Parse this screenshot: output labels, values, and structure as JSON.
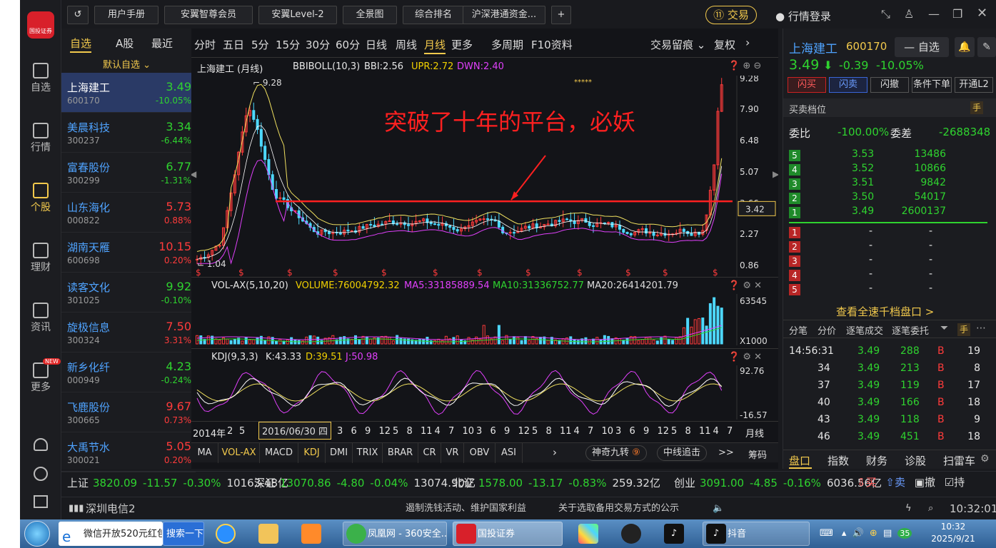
{
  "topbar": {
    "buttons": [
      "用户手册",
      "安翼智尊会员",
      "安翼Level-2",
      "全景图",
      "综合排名",
      "沪深港通资金..."
    ],
    "trade_label": "交易",
    "login_label": "行情登录"
  },
  "rail": [
    {
      "label": "自选",
      "icon": "watchlist-icon"
    },
    {
      "label": "行情",
      "icon": "market-icon"
    },
    {
      "label": "个股",
      "icon": "stock-icon"
    },
    {
      "label": "理财",
      "icon": "finance-icon"
    },
    {
      "label": "资讯",
      "icon": "news-icon"
    },
    {
      "label": "更多",
      "icon": "more-icon",
      "badge": "NEW"
    }
  ],
  "watchlist": {
    "tabs": [
      "自选",
      "A股",
      "最近"
    ],
    "group_label": "默认自选",
    "items": [
      {
        "name": "上海建工",
        "code": "600170",
        "price": "3.49",
        "pct": "-10.05%",
        "dir": "down"
      },
      {
        "name": "美晨科技",
        "code": "300237",
        "price": "3.34",
        "pct": "-6.44%",
        "dir": "down"
      },
      {
        "name": "富春股份",
        "code": "300299",
        "price": "6.77",
        "pct": "-1.31%",
        "dir": "down"
      },
      {
        "name": "山东海化",
        "code": "000822",
        "price": "5.73",
        "pct": "0.88%",
        "dir": "up"
      },
      {
        "name": "湖南天雁",
        "code": "600698",
        "price": "10.15",
        "pct": "0.20%",
        "dir": "up"
      },
      {
        "name": "读客文化",
        "code": "301025",
        "price": "9.92",
        "pct": "-0.10%",
        "dir": "down"
      },
      {
        "name": "旋极信息",
        "code": "300324",
        "price": "7.50",
        "pct": "3.31%",
        "dir": "up"
      },
      {
        "name": "新乡化纤",
        "code": "000949",
        "price": "4.23",
        "pct": "-0.24%",
        "dir": "down"
      },
      {
        "name": "飞鹿股份",
        "code": "300665",
        "price": "9.67",
        "pct": "0.73%",
        "dir": "up"
      },
      {
        "name": "大禹节水",
        "code": "300021",
        "price": "5.05",
        "pct": "0.20%",
        "dir": "up"
      }
    ]
  },
  "chart": {
    "period_tabs": [
      "分时",
      "五日",
      "5分",
      "15分",
      "30分",
      "60分",
      "日线",
      "周线",
      "月线",
      "更多",
      "多周期",
      "F10资料"
    ],
    "right_tabs": [
      "交易留痕",
      "复权"
    ],
    "main_title": "上海建工 (月线)",
    "bbi_label": "BBIBOLL(10,3)",
    "bbi": "BBI:2.56",
    "upr": "UPR:2.72",
    "dwn": "DWN:2.40",
    "annotation": "突破了十年的平台，必妖",
    "hi_label": "9.28",
    "lo_label": "1.04",
    "cursor_value": "3.42",
    "stars": "*****",
    "y_ticks": [
      "9.28",
      "7.90",
      "6.48",
      "5.07",
      "3.66",
      "2.27",
      "0.86"
    ],
    "vol_title": "VOL-AX(5,10,20)",
    "vol": "VOLUME:76004792.32",
    "ma5": "MA5:33185889.54",
    "ma10": "MA10:31336752.77",
    "ma20": "MA20:26414201.79",
    "vol_y": [
      "63545",
      "X1000"
    ],
    "kdj_title": "KDJ(9,3,3)",
    "kdj_k": "K:43.33",
    "kdj_d": "D:39.51",
    "kdj_j": "J:50.98",
    "kdj_y": [
      "92.76",
      "-16.57"
    ],
    "x_start": "2014年",
    "x_ticks": [
      "2",
      "5",
      "8",
      "11",
      "3",
      "6",
      "9",
      "12",
      "5",
      "8",
      "11",
      "4",
      "7",
      "10",
      "3",
      "6",
      "9",
      "12",
      "5",
      "8",
      "11",
      "4",
      "7",
      "10",
      "3",
      "6",
      "9",
      "12",
      "5",
      "8",
      "11",
      "4",
      "7"
    ],
    "date_box": "2016/06/30 四",
    "period_label": "月线",
    "indicators": [
      "MA",
      "VOL-AX",
      "MACD",
      "KDJ",
      "DMI",
      "TRIX",
      "BRAR",
      "CR",
      "VR",
      "OBV",
      "ASI"
    ],
    "special_btns": [
      "神奇九转",
      "中线追击",
      ">>",
      "筹码"
    ]
  },
  "quote": {
    "name": "上海建工",
    "code": "600170",
    "price": "3.49",
    "change": "-0.39",
    "pct": "-10.05%",
    "watch_btn": "自选",
    "actions": [
      "闪买",
      "闪卖",
      "闪撤",
      "条件下单",
      "开通L2"
    ],
    "ob_title": "买卖档位",
    "ratio_label": "委比",
    "ratio": "-100.00%",
    "diff_label": "委差",
    "diff": "-2688348",
    "asks": [
      {
        "lvl": "5",
        "price": "3.53",
        "vol": "13486"
      },
      {
        "lvl": "4",
        "price": "3.52",
        "vol": "10866"
      },
      {
        "lvl": "3",
        "price": "3.51",
        "vol": "9842"
      },
      {
        "lvl": "2",
        "price": "3.50",
        "vol": "54017"
      },
      {
        "lvl": "1",
        "price": "3.49",
        "vol": "2600137"
      }
    ],
    "bids": [
      {
        "lvl": "1",
        "price": "-",
        "vol": "-"
      },
      {
        "lvl": "2",
        "price": "-",
        "vol": "-"
      },
      {
        "lvl": "3",
        "price": "-",
        "vol": "-"
      },
      {
        "lvl": "4",
        "price": "-",
        "vol": "-"
      },
      {
        "lvl": "5",
        "price": "-",
        "vol": "-"
      }
    ],
    "depth_link": "查看全速千档盘口 >",
    "tick_tabs": [
      "分笔",
      "分价",
      "逐笔成交",
      "逐笔委托"
    ],
    "ticks": [
      {
        "t": "14:56:31",
        "p": "3.49",
        "v": "288",
        "s": "B",
        "n": "19"
      },
      {
        "t": "34",
        "p": "3.49",
        "v": "213",
        "s": "B",
        "n": "8"
      },
      {
        "t": "37",
        "p": "3.49",
        "v": "119",
        "s": "B",
        "n": "17"
      },
      {
        "t": "40",
        "p": "3.49",
        "v": "166",
        "s": "B",
        "n": "18"
      },
      {
        "t": "43",
        "p": "3.49",
        "v": "118",
        "s": "B",
        "n": "9"
      },
      {
        "t": "46",
        "p": "3.49",
        "v": "451",
        "s": "B",
        "n": "18"
      }
    ],
    "bottom_tabs": [
      "盘口",
      "指数",
      "财务",
      "诊股",
      "扫雷车"
    ]
  },
  "indices": [
    {
      "name": "上证",
      "v": "3820.09",
      "c": "-11.57",
      "p": "-0.30%",
      "a": "10163.48亿"
    },
    {
      "name": "深证",
      "v": "13070.86",
      "c": "-4.80",
      "p": "-0.04%",
      "a": "13074.90亿"
    },
    {
      "name": "北证",
      "v": "1578.00",
      "c": "-13.17",
      "p": "-0.83%",
      "a": "259.32亿"
    },
    {
      "name": "创业",
      "v": "3091.00",
      "c": "-4.85",
      "p": "-0.16%",
      "a": "6036.56亿"
    }
  ],
  "index_actions": [
    "买",
    "卖",
    "撤",
    "持"
  ],
  "status": {
    "server": "深圳电信2",
    "notice1": "遏制洗钱活动、维护国家利益",
    "notice2": "关于选取备用交易方式的公示",
    "time": "10:32:01"
  },
  "taskbar": {
    "items": [
      "微信开放520元红包",
      "搜索一下",
      "凤凰网 - 360安全...",
      "国投证券",
      "抖音"
    ],
    "clock_time": "10:32",
    "clock_date": "2025/9/21",
    "tray_badge": "35"
  },
  "app_logo_text": "国投证券",
  "colors": {
    "up": "#ff3b3b",
    "down": "#2fd32f",
    "accent": "#f2c94c",
    "link": "#4fa3ff"
  }
}
